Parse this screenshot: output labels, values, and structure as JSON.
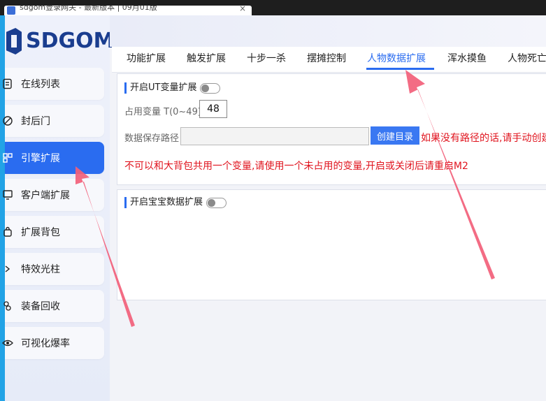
{
  "window": {
    "tab_title": "sdgom登录网关 - 最新版本 | 09月01版",
    "close_glyph": "×"
  },
  "logo": {
    "text": "SDGOM"
  },
  "sidebar": {
    "items": [
      {
        "label": "在线列表",
        "icon": "list-icon",
        "active": false
      },
      {
        "label": "封后门",
        "icon": "block-icon",
        "active": false
      },
      {
        "label": "引擎扩展",
        "icon": "grid-icon",
        "active": true
      },
      {
        "label": "客户端扩展",
        "icon": "monitor-icon",
        "active": false
      },
      {
        "label": "扩展背包",
        "icon": "bag-icon",
        "active": false
      },
      {
        "label": "特效光柱",
        "icon": "chevron-right-icon",
        "active": false
      },
      {
        "label": "装备回收",
        "icon": "recycle-icon",
        "active": false
      },
      {
        "label": "可视化爆率",
        "icon": "eye-icon",
        "active": false
      }
    ]
  },
  "tabs": [
    {
      "label": "功能扩展"
    },
    {
      "label": "触发扩展"
    },
    {
      "label": "十步一杀"
    },
    {
      "label": "摆摊控制"
    },
    {
      "label": "人物数据扩展",
      "active": true
    },
    {
      "label": "浑水摸鱼"
    },
    {
      "label": "人物死亡"
    }
  ],
  "panel1": {
    "title": "开启UT变量扩展",
    "toggle_on": false,
    "var_label": "占用变量 T(0~49)",
    "var_value": "48",
    "path_label": "数据保存路径",
    "path_value": "",
    "create_button": "创建目录",
    "hint": "如果没有路径的话,请手动创建",
    "warning": "不可以和大背包共用一个变量,请使用一个未占用的变量,开启或关闭后请重启M2"
  },
  "panel2": {
    "title": "开启宝宝数据扩展",
    "toggle_on": false
  },
  "colors": {
    "accent": "#2a6cf0",
    "warning": "#e0141e",
    "arrow": "#f2607a"
  }
}
